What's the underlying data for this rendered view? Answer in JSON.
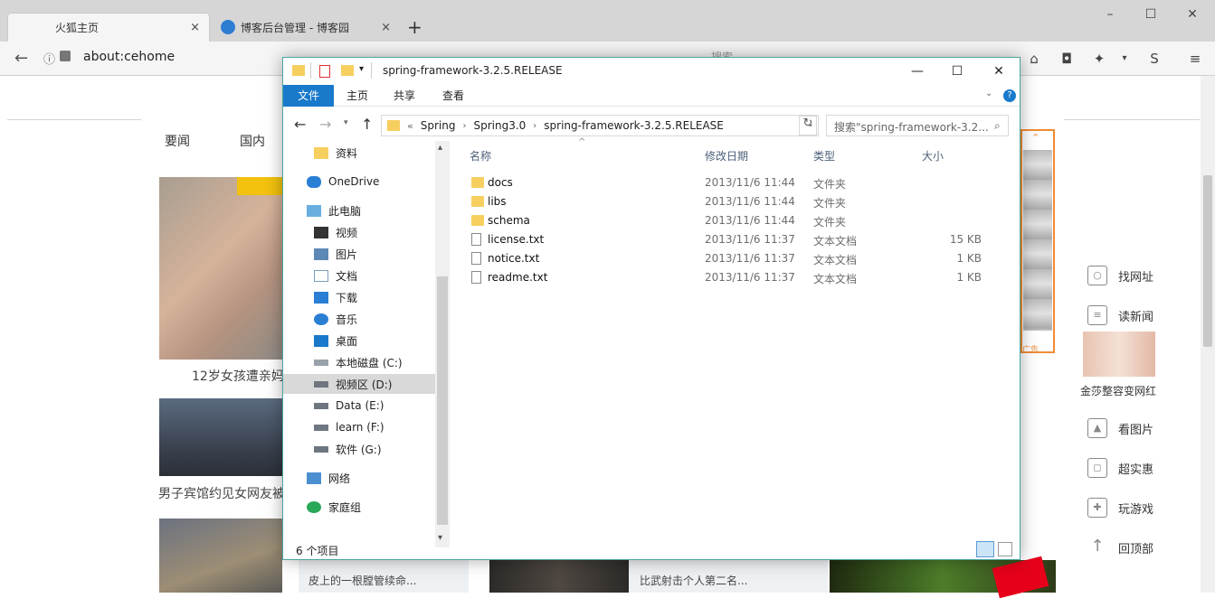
{
  "browser": {
    "tabs": [
      {
        "label": "火狐主页",
        "close": "×"
      },
      {
        "label": "博客后台管理 - 博客园",
        "close": "×"
      }
    ],
    "new_tab": "+",
    "window_controls": {
      "minimize": "–",
      "maximize": "☐",
      "close": "✕"
    },
    "url": "about:cehome",
    "search_placeholder": "搜索"
  },
  "webpage": {
    "nav": [
      "要闻",
      "国内"
    ],
    "captions": [
      "12岁女孩遭亲妈",
      "男子宾馆约见女网友被",
      "皮上的一根膛管续命...",
      "比武射击个人第二名..."
    ],
    "side_links": [
      "找网址",
      "读新闻",
      "看图片",
      "超实惠",
      "玩游戏",
      "回顶部"
    ],
    "ad_caption": "金莎整容变网红",
    "ad_label": "广告"
  },
  "explorer": {
    "title": "spring-framework-3.2.5.RELEASE",
    "title_controls": {
      "minimize": "—",
      "maximize": "☐",
      "close": "✕"
    },
    "ribbon_tabs": [
      "文件",
      "主页",
      "共享",
      "查看"
    ],
    "breadcrumb": [
      "Spring",
      "Spring3.0",
      "spring-framework-3.2.5.RELEASE"
    ],
    "search_placeholder": "搜索\"spring-framework-3.2...",
    "nav_items": [
      {
        "label": "资料",
        "icon": "folder-icon"
      },
      {
        "label": "OneDrive",
        "icon": "cloud-icon"
      },
      {
        "label": "此电脑",
        "icon": "computer-icon"
      },
      {
        "label": "视频",
        "icon": "video-icon"
      },
      {
        "label": "图片",
        "icon": "pictures-icon"
      },
      {
        "label": "文档",
        "icon": "documents-icon"
      },
      {
        "label": "下载",
        "icon": "download-icon"
      },
      {
        "label": "音乐",
        "icon": "music-icon"
      },
      {
        "label": "桌面",
        "icon": "desktop-icon"
      },
      {
        "label": "本地磁盘 (C:)",
        "icon": "drive-icon"
      },
      {
        "label": "视频区 (D:)",
        "icon": "drive-icon"
      },
      {
        "label": "Data (E:)",
        "icon": "drive-icon"
      },
      {
        "label": "learn (F:)",
        "icon": "drive-icon"
      },
      {
        "label": "软件 (G:)",
        "icon": "drive-icon"
      },
      {
        "label": "网络",
        "icon": "network-icon"
      },
      {
        "label": "家庭组",
        "icon": "homegroup-icon"
      }
    ],
    "columns": {
      "name": "名称",
      "date": "修改日期",
      "type": "类型",
      "size": "大小"
    },
    "files": [
      {
        "name": "docs",
        "date": "2013/11/6 11:44",
        "type": "文件夹",
        "size": "",
        "kind": "folder"
      },
      {
        "name": "libs",
        "date": "2013/11/6 11:44",
        "type": "文件夹",
        "size": "",
        "kind": "folder"
      },
      {
        "name": "schema",
        "date": "2013/11/6 11:44",
        "type": "文件夹",
        "size": "",
        "kind": "folder"
      },
      {
        "name": "license.txt",
        "date": "2013/11/6 11:37",
        "type": "文本文档",
        "size": "15 KB",
        "kind": "text"
      },
      {
        "name": "notice.txt",
        "date": "2013/11/6 11:37",
        "type": "文本文档",
        "size": "1 KB",
        "kind": "text"
      },
      {
        "name": "readme.txt",
        "date": "2013/11/6 11:37",
        "type": "文本文档",
        "size": "1 KB",
        "kind": "text"
      }
    ],
    "status": "6 个项目"
  },
  "colors": {
    "accent": "#1979ca",
    "folder": "#f6cf5f",
    "window_border": "#4aa6a0"
  }
}
